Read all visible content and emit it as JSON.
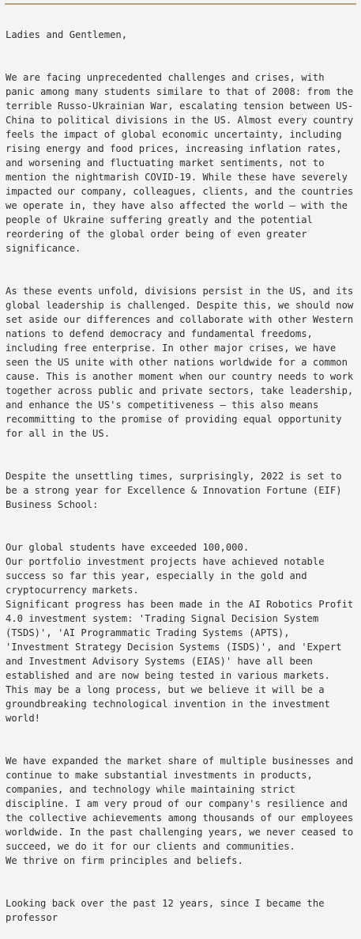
{
  "letter": {
    "greeting": "Ladies and Gentlemen,",
    "paragraphs": [
      "We are facing unprecedented challenges and crises, with panic among many students similare to that of 2008: from the terrible Russo-Ukrainian War, escalating tension between US-China to political divisions in the US. Almost every country feels the impact of global economic uncertainty, including rising energy and food prices, increasing inflation rates, and worsening and fluctuating market sentiments, not to mention the nightmarish COVID-19. While these have severely impacted our company, colleagues, clients, and the countries we operate in, they have also affected the world — with the people of Ukraine suffering greatly and the potential reordering of the global order being of even greater significance.",
      "As these events unfold, divisions persist in the US, and its global leadership is challenged. Despite this, we should now set aside our differences and collaborate with other Western nations to defend democracy and fundamental freedoms, including free enterprise. In other major crises, we have seen the US unite with other nations worldwide for a common cause. This is another moment when our country needs to work together across public and private sectors, take leadership, and enhance the US's competitiveness — this also means recommitting to the promise of providing equal opportunity for all in the US.",
      "Despite the unsettling times, surprisingly, 2022 is set to be a strong year for Excellence & Innovation Fortune (EIF) Business School:",
      "Our global students have exceeded 100,000.\nOur portfolio investment projects have achieved notable success so far this year, especially in the gold and cryptocurrency markets.\nSignificant progress has been made in the AI Robotics Profit 4.0 investment system: 'Trading Signal Decision System (TSDS)', 'AI Programmatic Trading Systems (APTS), 'Investment Strategy Decision Systems (ISDS)', and 'Expert and Investment Advisory Systems (EIAS)' have all been established and are now being tested in various markets. This may be a long process, but we believe it will be a groundbreaking technological invention in the investment world!",
      "We have expanded the market share of multiple businesses and continue to make substantial investments in products, companies, and technology while maintaining strict discipline. I am very proud of our company's resilience and the collective achievements among thousands of our employees worldwide. In the past challenging years, we never ceased to succeed, we do it for our clients and communities.\nWe thrive on firm principles and beliefs.",
      "Looking back over the past 12 years, since I became the professor"
    ]
  }
}
